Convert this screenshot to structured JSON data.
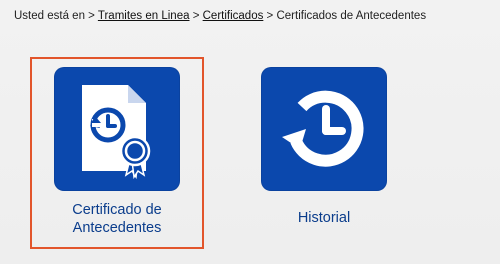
{
  "breadcrumb": {
    "prefix": "Usted está en >",
    "link1": "Tramites en Linea",
    "sep1": ">",
    "link2": "Certificados",
    "sep2": ">",
    "current": "Certificados de Antecedentes"
  },
  "tiles": [
    {
      "label_line1": "Certificado de",
      "label_line2": "Antecedentes",
      "icon": "certificate-document-icon",
      "selected": true
    },
    {
      "label": "Historial",
      "icon": "history-clock-icon"
    }
  ],
  "colors": {
    "tile_blue": "#0b48ad",
    "label_blue": "#0b3d8c",
    "selection_border": "#e2552b"
  }
}
